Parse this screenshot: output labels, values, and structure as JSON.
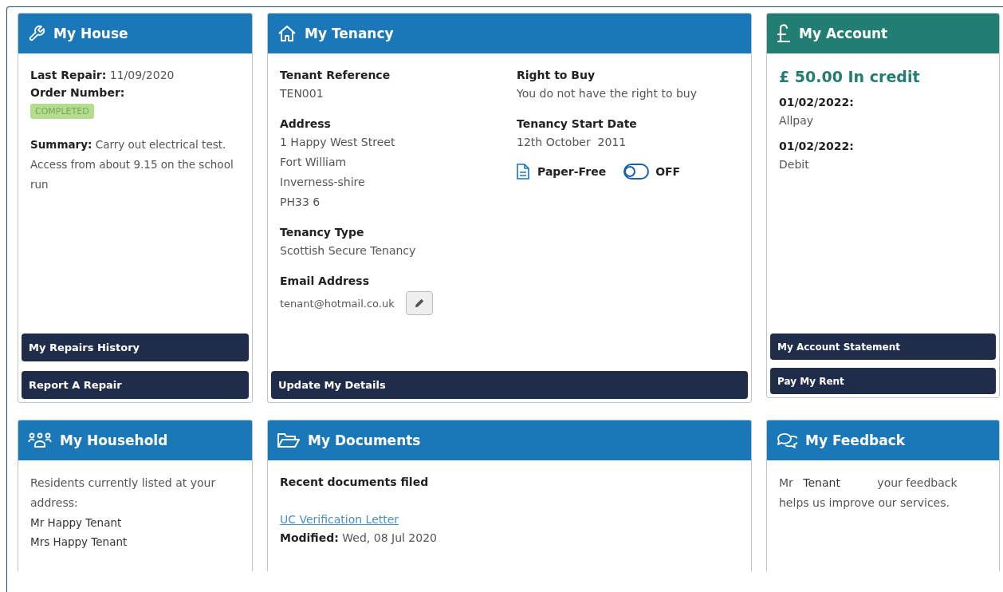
{
  "house": {
    "title": "My House",
    "last_repair_label": "Last Repair:",
    "last_repair": "11/09/2020",
    "order_label": "Order Number:",
    "status": "COMPLETED",
    "summary_label": "Summary:",
    "summary": "Carry out electrical test. Access from about 9.15 on the school run",
    "buttons": [
      "My Repairs History",
      "Report A Repair"
    ]
  },
  "tenancy": {
    "title": "My Tenancy",
    "left_fields": [
      {
        "label": "Tenant Reference",
        "lines": [
          "TEN001"
        ]
      },
      {
        "label": "Address",
        "lines": [
          "1 Happy West Street",
          "Fort William",
          "Inverness-shire",
          "PH33 6"
        ]
      },
      {
        "label": "Tenancy Type",
        "lines": [
          "Scottish Secure Tenancy"
        ]
      }
    ],
    "right_fields": [
      {
        "label": "Right to Buy",
        "lines": [
          "You do not have the right to buy"
        ]
      },
      {
        "label": "Tenancy Start Date",
        "lines": [
          "12th October  2011"
        ]
      }
    ],
    "email_label": "Email Address",
    "email": "tenant@hotmail.co.uk",
    "paper_free": {
      "label": "Paper-Free",
      "on": false,
      "state_label": "OFF"
    },
    "button": "Update My Details"
  },
  "account": {
    "title": "My Account",
    "balance": "£ 50.00 In credit",
    "payments": [
      {
        "date": "01/02/2022:",
        "method": "Allpay"
      },
      {
        "date": "01/02/2022:",
        "method": "Debit"
      }
    ],
    "buttons": [
      "My Account Statement",
      "Pay My Rent"
    ]
  },
  "household": {
    "title": "My Household",
    "intro": "Residents currently listed at your address:",
    "residents": [
      "Mr Happy Tenant",
      "Mrs Happy Tenant"
    ]
  },
  "documents": {
    "title": "My Documents",
    "heading": "Recent documents filed",
    "items": [
      {
        "name": "UC Verification Letter",
        "modified_label": "Modified:",
        "modified": "Wed, 08 Jul 2020"
      }
    ]
  },
  "feedback": {
    "title": "My Feedback",
    "parts": [
      "Mr",
      "Tenant",
      "your feedback helps us improve our services."
    ]
  }
}
